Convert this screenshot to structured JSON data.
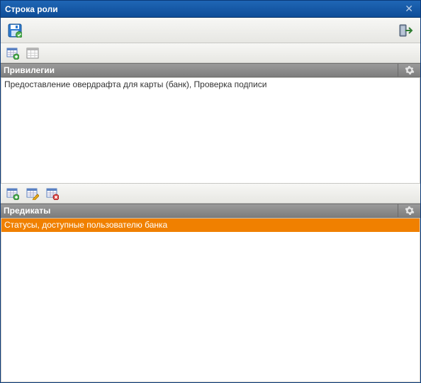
{
  "window": {
    "title": "Строка роли"
  },
  "toolbar": {
    "save": "save",
    "exit": "exit"
  },
  "privileges": {
    "header": "Привилегии",
    "toolbarIcons": [
      "add",
      "view"
    ],
    "rows": [
      "Предоставление овердрафта для карты (банк), Проверка подписи"
    ]
  },
  "predicates": {
    "header": "Предикаты",
    "toolbarIcons": [
      "add",
      "edit",
      "delete"
    ],
    "rows": [
      "Статусы, доступные пользователю банка"
    ],
    "selectedIndex": 0
  }
}
